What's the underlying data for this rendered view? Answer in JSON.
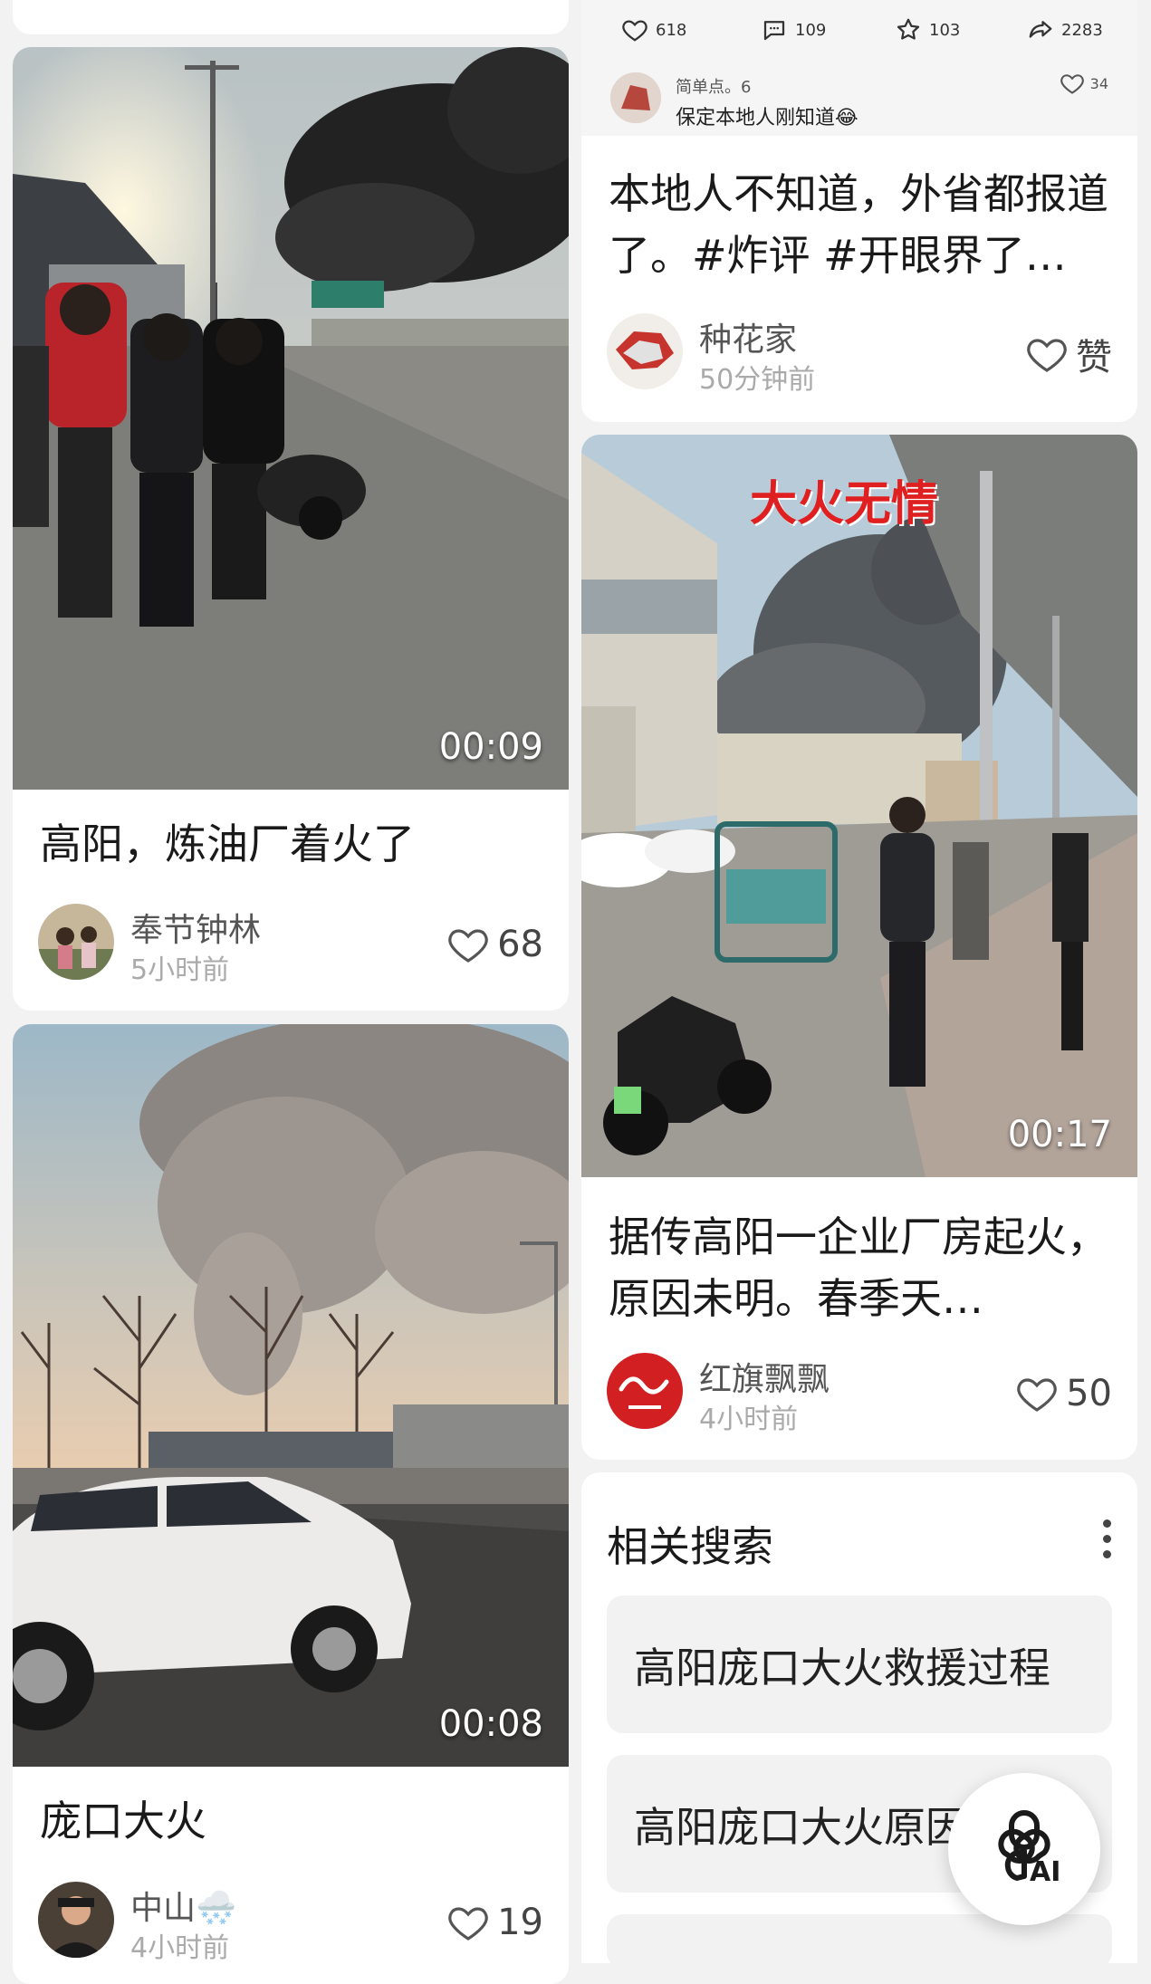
{
  "left_column": {
    "card1": {
      "duration": "00:09",
      "title": "高阳，炼油厂着火了",
      "author": "奉节钟林",
      "time": "5小时前",
      "likes": "68"
    },
    "card2": {
      "duration": "00:08",
      "title": "庞口大火",
      "author": "中山🌨️",
      "time": "4小时前",
      "likes": "19"
    }
  },
  "right_column": {
    "card0": {
      "stats": {
        "like_count": "618",
        "comment_count": "109",
        "star_count": "103",
        "share_count": "2283"
      },
      "comment": {
        "user": "简单点。6",
        "text": "保定本地人刚知道😂",
        "likes": "34"
      },
      "title": "本地人不知道，外省都报道了。#炸评 #开眼界了…",
      "author": "种花家",
      "time": "50分钟前",
      "like_label": "赞"
    },
    "card1": {
      "overlay_text": "大火无情",
      "duration": "00:17",
      "title": "据传高阳一企业厂房起火，原因未明。春季天…",
      "author": "红旗飘飘",
      "time": "4小时前",
      "likes": "50"
    },
    "related": {
      "title": "相关搜索",
      "items": [
        "高阳庞口大火救援过程",
        "高阳庞口大火原因"
      ]
    }
  },
  "ai_button": {
    "label": "AI"
  },
  "colors": {
    "accent_red": "#e02020",
    "card_bg": "#ffffff",
    "page_bg": "#f2f2f2"
  }
}
